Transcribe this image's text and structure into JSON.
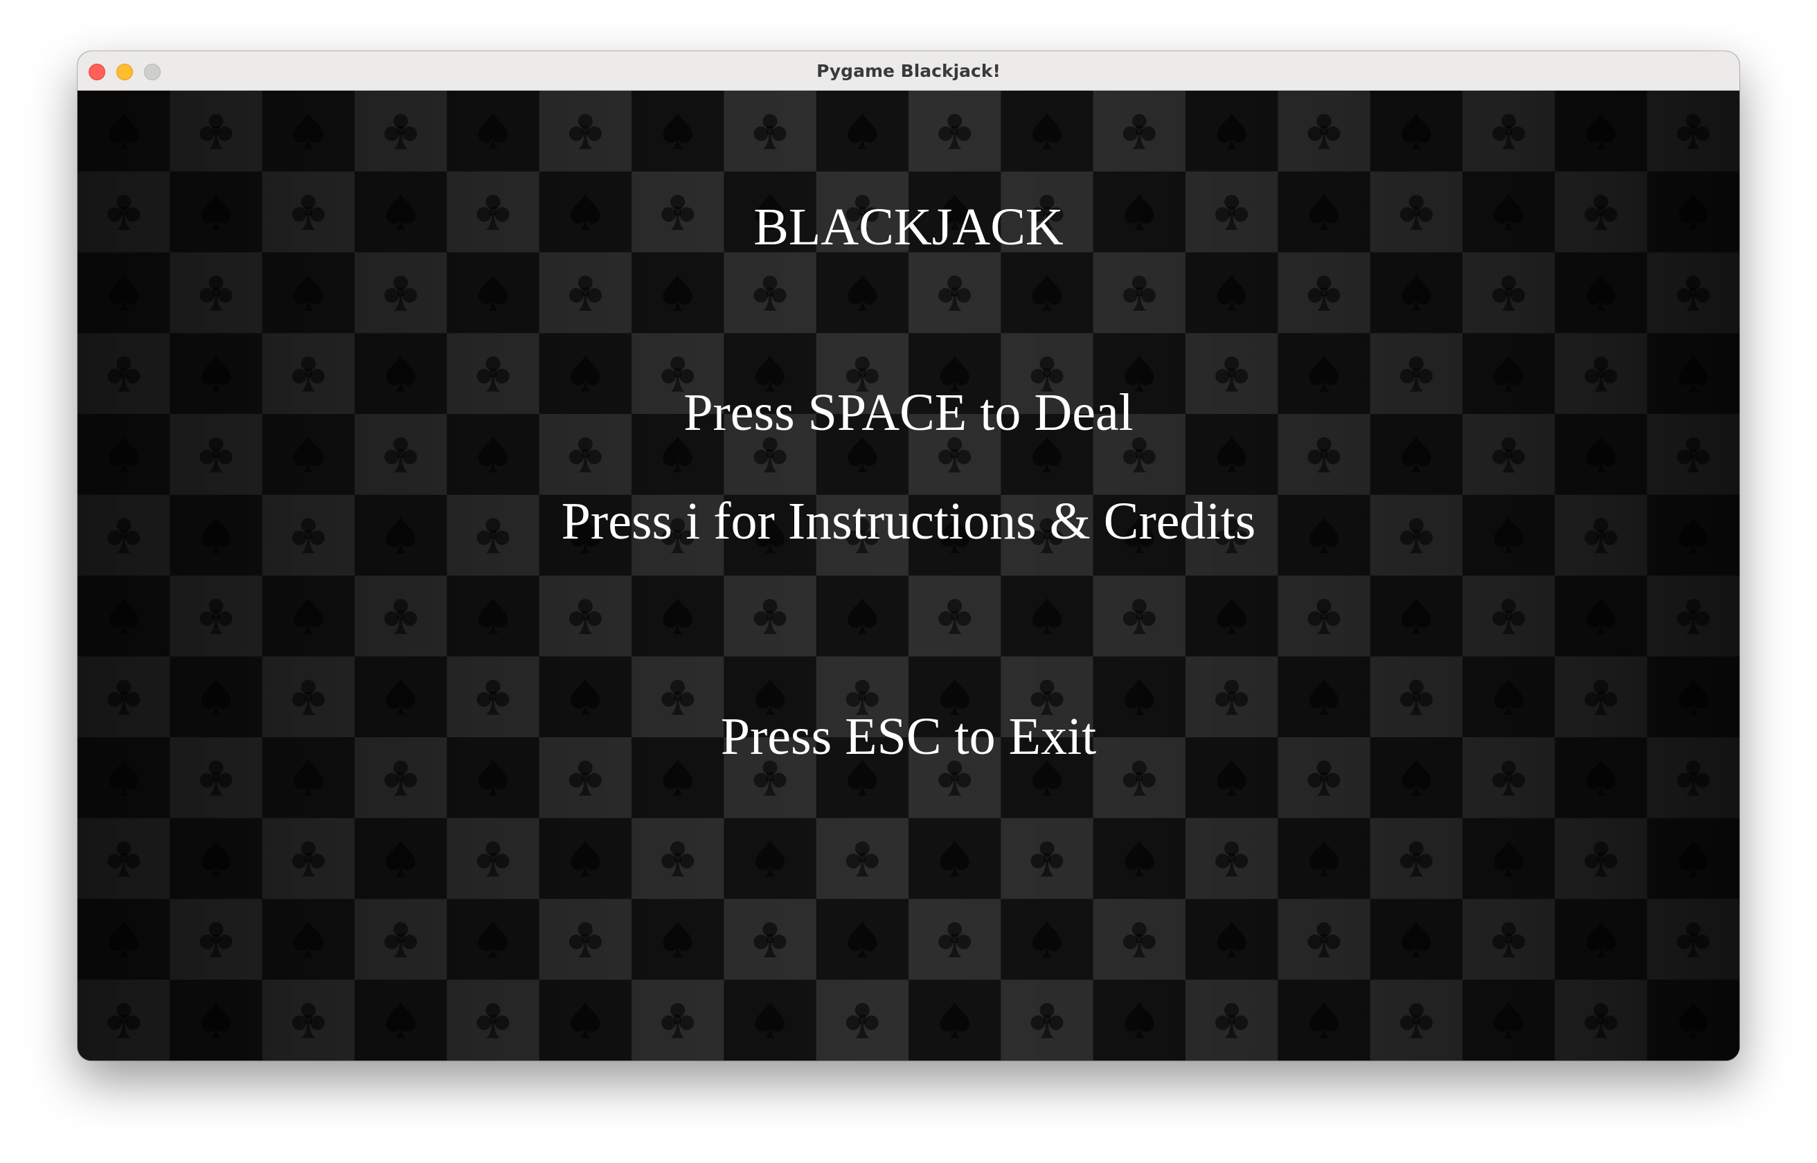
{
  "window": {
    "title": "Pygame Blackjack!",
    "controls": [
      "close",
      "minimize",
      "maximize"
    ]
  },
  "background": {
    "pattern": "checkerboard",
    "icons": [
      "spade-icon",
      "club-icon"
    ],
    "colors": {
      "dark_square": "#111111",
      "light_square": "#2e2e2e",
      "glyph": "#000000"
    }
  },
  "menu": {
    "title": "BLACKJACK",
    "deal_prompt": "Press SPACE to Deal",
    "instructions_prompt": "Press i for Instructions & Credits",
    "exit_prompt": "Press ESC to Exit"
  },
  "colors": {
    "text": "#ffffff",
    "close": "#fe5f57",
    "minimize": "#febc2e",
    "maximize": "#cfcfce"
  }
}
